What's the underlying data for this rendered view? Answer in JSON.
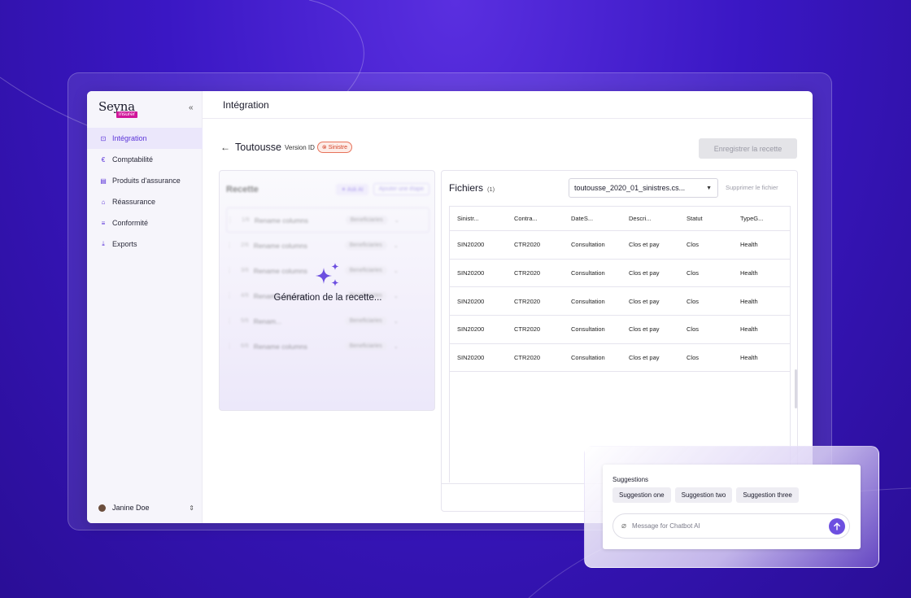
{
  "app": {
    "logo": "Seyna",
    "logo_badge": "insurer",
    "collapse_icon": "«"
  },
  "sidebar": {
    "items": [
      {
        "label": "Intégration",
        "icon": "plug-icon",
        "active": true
      },
      {
        "label": "Comptabilité",
        "icon": "euro-icon",
        "active": false
      },
      {
        "label": "Produits d'assurance",
        "icon": "box-icon",
        "active": false
      },
      {
        "label": "Réassurance",
        "icon": "bank-icon",
        "active": false
      },
      {
        "label": "Conformité",
        "icon": "check-list-icon",
        "active": false
      },
      {
        "label": "Exports",
        "icon": "download-icon",
        "active": false
      }
    ],
    "user": {
      "name": "Janine Doe"
    }
  },
  "header": {
    "title": "Intégration"
  },
  "page": {
    "title": "Toutousse",
    "version_label": "Version ID",
    "tag": "Sinistre",
    "save_button": "Enregistrer la recette"
  },
  "recette": {
    "title": "Recette",
    "ask_ai": "Ask AI",
    "add_step": "Ajouter une étape",
    "steps": [
      {
        "num": "1/6",
        "label": "Rename columns",
        "tag": "Beneficiaries"
      },
      {
        "num": "2/6",
        "label": "Rename columns",
        "tag": "Beneficiaries"
      },
      {
        "num": "3/6",
        "label": "Rename columns",
        "tag": "Beneficiaries"
      },
      {
        "num": "4/6",
        "label": "Rename columns",
        "tag": "Beneficiaries"
      },
      {
        "num": "5/6",
        "label": "Renam...",
        "tag": "Beneficiaries"
      },
      {
        "num": "6/6",
        "label": "Rename columns",
        "tag": "Beneficiaries"
      }
    ],
    "generating_text": "Génération de la recette..."
  },
  "files": {
    "title": "Fichiers",
    "count": "(1)",
    "selected_file": "toutousse_2020_01_sinistres.cs...",
    "delete_label": "Supprimer le fichier",
    "columns": [
      "Sinistr...",
      "Contra...",
      "DateS...",
      "Descri...",
      "Statut",
      "TypeG..."
    ],
    "rows": [
      [
        "SIN20200",
        "CTR2020",
        "Consultation",
        "Clos et pay",
        "Clos",
        "Health"
      ],
      [
        "SIN20200",
        "CTR2020",
        "Consultation",
        "Clos et pay",
        "Clos",
        "Health"
      ],
      [
        "SIN20200",
        "CTR2020",
        "Consultation",
        "Clos et pay",
        "Clos",
        "Health"
      ],
      [
        "SIN20200",
        "CTR2020",
        "Consultation",
        "Clos et pay",
        "Clos",
        "Health"
      ],
      [
        "SIN20200",
        "CTR2020",
        "Consultation",
        "Clos et pay",
        "Clos",
        "Health"
      ]
    ]
  },
  "chat": {
    "suggestions_title": "Suggestions",
    "suggestions": [
      "Suggestion one",
      "Suggestion two",
      "Suggestion three"
    ],
    "placeholder": "Message for Chatbot AI"
  },
  "colors": {
    "accent": "#6d4fe0",
    "brand_badge": "#d0169a",
    "tag": "#d4442a"
  }
}
